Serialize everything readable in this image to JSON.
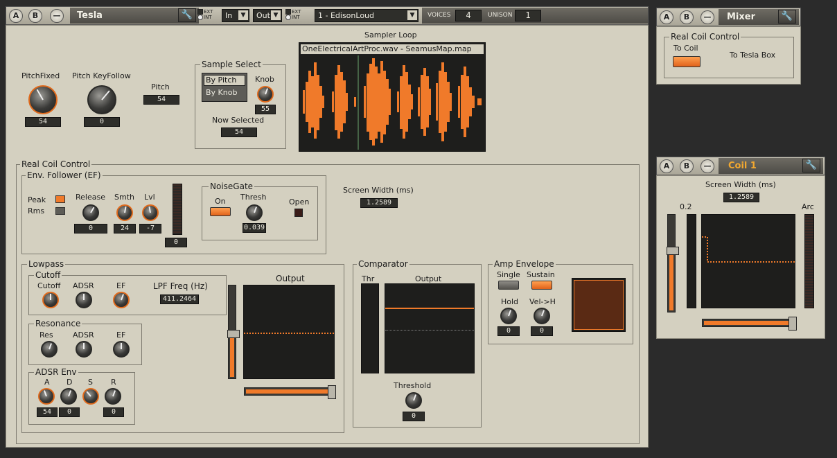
{
  "tesla": {
    "title": "Tesla",
    "btn_a": "A",
    "btn_b": "B",
    "btn_minus": "—",
    "ext": "EXT",
    "int": "INT",
    "in_select": "In",
    "out_select": "Out",
    "preset": "1 - EdisonLoud",
    "voices_label": "VOICES",
    "voices_value": "4",
    "unison_label": "UNISON",
    "unison_value": "1",
    "pitch_fixed_label": "PitchFixed",
    "pitch_fixed_value": "54",
    "pitch_keyfollow_label": "Pitch KeyFollow",
    "pitch_keyfollow_value": "0",
    "pitch_label": "Pitch",
    "pitch_value": "54",
    "sample_select": {
      "title": "Sample Select",
      "by_pitch": "By Pitch",
      "by_knob": "By Knob",
      "knob_label": "Knob",
      "knob_value": "55",
      "now_selected_label": "Now Selected",
      "now_selected_value": "54"
    },
    "sampler_loop": {
      "title": "Sampler Loop",
      "file": "OneElectricalArtProc.wav - SeamusMap.map"
    },
    "real_coil": {
      "title": "Real Coil Control",
      "env_follower": {
        "title": "Env. Follower (EF)",
        "peak": "Peak",
        "rms": "Rms",
        "release_label": "Release",
        "release_value": "0",
        "smth_label": "Smth",
        "smth_value": "24",
        "lvl_label": "Lvl",
        "lvl_value": "-7",
        "meter_value": "0"
      },
      "noisegate": {
        "title": "NoiseGate",
        "on": "On",
        "thresh_label": "Thresh",
        "thresh_value": "0.039",
        "open": "Open"
      },
      "screen_width_label": "Screen Width (ms)",
      "screen_width_value": "1.2589"
    },
    "lowpass": {
      "title": "Lowpass",
      "cutoff_group": "Cutoff",
      "cutoff": "Cutoff",
      "adsr": "ADSR",
      "ef": "EF",
      "lpf_freq_label": "LPF Freq (Hz)",
      "lpf_freq_value": "411.2464",
      "resonance_group": "Resonance",
      "res": "Res",
      "res_adsr": "ADSR",
      "res_ef": "EF",
      "adsr_env_group": "ADSR Env",
      "a": "A",
      "d": "D",
      "s": "S",
      "r": "R",
      "a_value": "54",
      "d_value": "0",
      "r_value": "0",
      "output_label": "Output"
    },
    "comparator": {
      "title": "Comparator",
      "thr": "Thr",
      "output": "Output",
      "threshold_label": "Threshold",
      "threshold_value": "0"
    },
    "amp_envelope": {
      "title": "Amp Envelope",
      "single": "Single",
      "sustain": "Sustain",
      "hold": "Hold",
      "hold_value": "0",
      "velh": "Vel->H",
      "velh_value": "0"
    }
  },
  "mixer": {
    "title": "Mixer",
    "btn_a": "A",
    "btn_b": "B",
    "btn_minus": "—",
    "group_title": "Real Coil Control",
    "to_coil": "To Coil",
    "to_tesla_box": "To Tesla Box"
  },
  "coil1": {
    "title": "Coil 1",
    "btn_a": "A",
    "btn_b": "B",
    "btn_minus": "—",
    "screen_width_label": "Screen Width (ms)",
    "screen_width_value": "1.2589",
    "level_label": "0.2",
    "arc_label": "Arc"
  },
  "colors": {
    "accent": "#f07a2a",
    "panel": "#d4d0c0",
    "screen": "#1e1e1c"
  }
}
